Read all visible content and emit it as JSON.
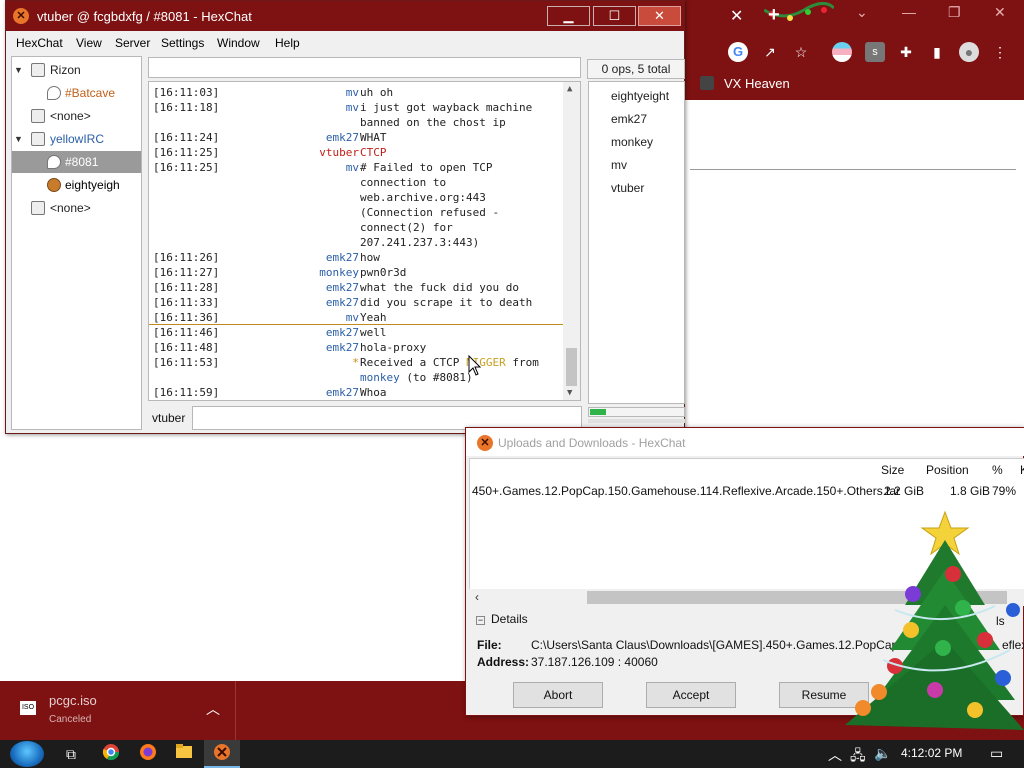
{
  "browser": {
    "bookmark": "VX Heaven",
    "download": {
      "filename": "pcgc.iso",
      "status": "Canceled",
      "file_icon_text": "ISO"
    }
  },
  "hexchat": {
    "title": "vtuber @ fcgbdxfg / #8081 - HexChat",
    "menu": [
      "HexChat",
      "View",
      "Server",
      "Settings",
      "Window",
      "Help"
    ],
    "tree": [
      {
        "label": "Rizon",
        "type": "server"
      },
      {
        "label": "#Batcave",
        "type": "channel"
      },
      {
        "label": "<none>",
        "type": "server"
      },
      {
        "label": "yellowIRC",
        "type": "network"
      },
      {
        "label": "#8081",
        "type": "channel-selected"
      },
      {
        "label": "eightyeigh",
        "type": "user"
      },
      {
        "label": "<none>",
        "type": "server"
      }
    ],
    "messages": [
      {
        "ts": "[16:11:03]",
        "nick": "mv",
        "nick_color": "blue",
        "lines": [
          "uh oh"
        ]
      },
      {
        "ts": "[16:11:18]",
        "nick": "mv",
        "nick_color": "blue",
        "lines": [
          "i just got wayback machine",
          "banned on the chost ip"
        ]
      },
      {
        "ts": "[16:11:24]",
        "nick": "emk27",
        "nick_color": "blue",
        "lines": [
          "WHAT"
        ]
      },
      {
        "ts": "[16:11:25]",
        "nick": "vtuber",
        "nick_color": "red",
        "lines": [
          "CTCP"
        ],
        "text_color": "red"
      },
      {
        "ts": "[16:11:25]",
        "nick": "mv",
        "nick_color": "blue",
        "lines": [
          " # Failed to open TCP",
          "connection to",
          "web.archive.org:443",
          "(Connection refused -",
          "connect(2) for",
          "207.241.237.3:443)"
        ]
      },
      {
        "ts": "[16:11:26]",
        "nick": "emk27",
        "nick_color": "blue",
        "lines": [
          "how"
        ]
      },
      {
        "ts": "[16:11:27]",
        "nick": "monkey",
        "nick_color": "blue",
        "lines": [
          "pwn0r3d"
        ]
      },
      {
        "ts": "[16:11:28]",
        "nick": "emk27",
        "nick_color": "blue",
        "lines": [
          "what the fuck did you do"
        ]
      },
      {
        "ts": "[16:11:33]",
        "nick": "emk27",
        "nick_color": "blue",
        "lines": [
          "did you scrape it to death"
        ]
      },
      {
        "ts": "[16:11:36]",
        "nick": "mv",
        "nick_color": "blue",
        "lines": [
          "Yeah"
        ]
      },
      {
        "ts": "[16:11:46]",
        "nick": "emk27",
        "nick_color": "blue",
        "lines": [
          "well"
        ]
      },
      {
        "ts": "[16:11:48]",
        "nick": "emk27",
        "nick_color": "blue",
        "lines": [
          "hola-proxy"
        ]
      },
      {
        "ts": "[16:11:53]",
        "nick": "*",
        "nick_color": "orange",
        "lines": [
          "Received a CTCP NIGGER from",
          "monkey (to #8081)"
        ],
        "ctcp": true
      },
      {
        "ts": "[16:11:59]",
        "nick": "emk27",
        "nick_color": "blue",
        "lines": [
          "Whoa"
        ]
      }
    ],
    "ctcp_parts": {
      "pre": "Received a CTCP ",
      "word": "NIGGER",
      "post": " from",
      "nick": "monkey",
      "tail": " (to #8081)"
    },
    "user_count": "0 ops, 5 total",
    "users": [
      "eightyeight",
      "emk27",
      "monkey",
      "mv",
      "vtuber"
    ],
    "input_nick": "vtuber",
    "input_value": "",
    "lag_fraction": 0.17
  },
  "dcc": {
    "title": "Uploads and Downloads - HexChat",
    "columns": [
      "Size",
      "Position",
      "%",
      "K"
    ],
    "row": {
      "file": "450+.Games.12.PopCap.150.Gamehouse.114.Reflexive.Arcade.150+.Others.tar",
      "size": "2.2 GiB",
      "position": "1.8 GiB",
      "percent": "79%"
    },
    "details_label": "Details",
    "file_label": "File:",
    "file_value": "C:\\Users\\Santa Claus\\Downloads\\[GAMES].450+.Games.12.PopCap",
    "file_value_tail": "eflex",
    "address_label": "Address:",
    "address_value": "37.187.126.109 : 40060",
    "buttons": {
      "abort": "Abort",
      "accept": "Accept",
      "resume": "Resume"
    },
    "partial_hidden_text": "ls"
  },
  "taskbar": {
    "clock": "4:12:02 PM"
  },
  "colors": {
    "brand_dark_red": "#7e1111",
    "nick_blue": "#2a5fa8",
    "nick_red": "#c0201a",
    "ctcp_yellow": "#c8a020",
    "lag_green": "#2fb34a"
  }
}
